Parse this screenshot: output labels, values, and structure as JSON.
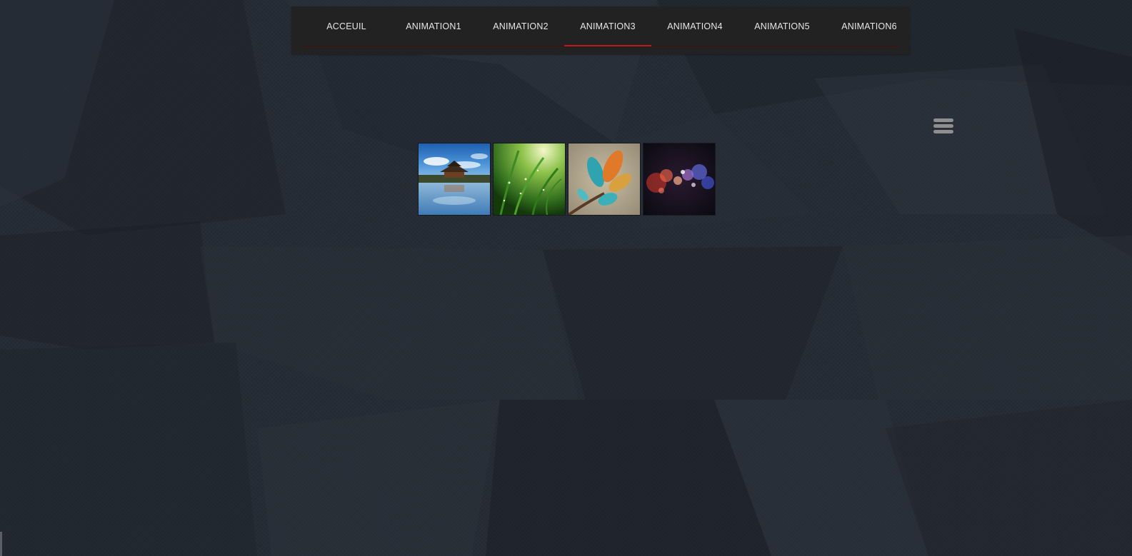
{
  "nav": {
    "items": [
      {
        "label": "ACCEUIL",
        "active": false
      },
      {
        "label": "ANIMATION1",
        "active": false
      },
      {
        "label": "ANIMATION2",
        "active": false
      },
      {
        "label": "ANIMATION3",
        "active": true
      },
      {
        "label": "ANIMATION4",
        "active": false
      },
      {
        "label": "ANIMATION5",
        "active": false
      },
      {
        "label": "ANIMATION6",
        "active": false
      }
    ],
    "active_color": "#c0161a"
  },
  "menu": {
    "icon": "hamburger-menu-icon"
  },
  "gallery": {
    "thumbnails": [
      {
        "subject": "pagoda-lake-photo"
      },
      {
        "subject": "grass-dew-photo"
      },
      {
        "subject": "leaves-branch-photo"
      },
      {
        "subject": "bokeh-lights-photo"
      }
    ]
  },
  "colors": {
    "background": "#262c35",
    "navbar": "#222222",
    "nav_text": "#e6e6e6",
    "accent": "#c0161a"
  }
}
